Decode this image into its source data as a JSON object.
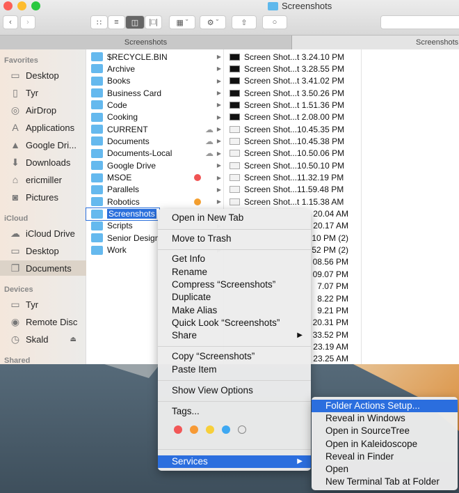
{
  "window": {
    "title": "Screenshots",
    "search_placeholder": ""
  },
  "toolbar": {
    "view_icons": [
      "icon-view-icon",
      "list-view-icon",
      "column-view-icon",
      "cover-flow-icon"
    ],
    "active_view": "column"
  },
  "tabs": [
    {
      "label": "Screenshots",
      "active": false
    },
    {
      "label": "Screenshots",
      "active": true
    }
  ],
  "sidebar": {
    "favorites_header": "Favorites",
    "favorites": [
      {
        "label": "Desktop",
        "icon": "desktop-icon"
      },
      {
        "label": "Tyr",
        "icon": "drive-icon"
      },
      {
        "label": "AirDrop",
        "icon": "airdrop-icon"
      },
      {
        "label": "Applications",
        "icon": "applications-icon"
      },
      {
        "label": "Google Dri...",
        "icon": "google-drive-icon"
      },
      {
        "label": "Downloads",
        "icon": "downloads-icon"
      },
      {
        "label": "ericmiller",
        "icon": "home-icon"
      },
      {
        "label": "Pictures",
        "icon": "camera-icon"
      }
    ],
    "icloud_header": "iCloud",
    "icloud": [
      {
        "label": "iCloud Drive",
        "icon": "cloud-icon"
      },
      {
        "label": "Desktop",
        "icon": "desktop-icon"
      },
      {
        "label": "Documents",
        "icon": "documents-icon",
        "selected": true
      }
    ],
    "devices_header": "Devices",
    "devices": [
      {
        "label": "Tyr",
        "icon": "laptop-icon"
      },
      {
        "label": "Remote Disc",
        "icon": "disc-icon"
      },
      {
        "label": "Skald",
        "icon": "timemachine-icon",
        "eject": true
      }
    ],
    "shared_header": "Shared"
  },
  "folders": [
    {
      "name": "$RECYCLE.BIN"
    },
    {
      "name": "Archive"
    },
    {
      "name": "Books"
    },
    {
      "name": "Business Card"
    },
    {
      "name": "Code"
    },
    {
      "name": "Cooking"
    },
    {
      "name": "CURRENT",
      "cloud": true
    },
    {
      "name": "Documents",
      "cloud": true
    },
    {
      "name": "Documents-Local",
      "cloud": true
    },
    {
      "name": "Google Drive"
    },
    {
      "name": "MSOE",
      "tag": "#f05454"
    },
    {
      "name": "Parallels"
    },
    {
      "name": "Robotics",
      "tag": "#f5a030"
    },
    {
      "name": "Screenshots",
      "selected": true
    },
    {
      "name": "Scripts"
    },
    {
      "name": "Senior Design"
    },
    {
      "name": "Work"
    }
  ],
  "files": [
    {
      "name": "Screen Shot...t 3.24.10 PM",
      "thumb": "dark"
    },
    {
      "name": "Screen Shot...t 3.28.55 PM",
      "thumb": "dark"
    },
    {
      "name": "Screen Shot...t 3.41.02 PM",
      "thumb": "dark"
    },
    {
      "name": "Screen Shot...t 3.50.26 PM",
      "thumb": "dark"
    },
    {
      "name": "Screen Shot...t 1.51.36 PM",
      "thumb": "dark"
    },
    {
      "name": "Screen Shot...t 2.08.00 PM",
      "thumb": "dark"
    },
    {
      "name": "Screen Shot...10.45.35 PM",
      "thumb": "light"
    },
    {
      "name": "Screen Shot...10.45.38 PM",
      "thumb": "light"
    },
    {
      "name": "Screen Shot...10.50.06 PM",
      "thumb": "light"
    },
    {
      "name": "Screen Shot...10.50.10 PM",
      "thumb": "light"
    },
    {
      "name": "Screen Shot...11.32.19 PM",
      "thumb": "light"
    },
    {
      "name": "Screen Shot...11.59.48 PM",
      "thumb": "light"
    },
    {
      "name": "Screen Shot...t 1.15.38 AM",
      "thumb": "light"
    },
    {
      "name": "20.04 AM",
      "partial": true
    },
    {
      "name": "20.17 AM",
      "partial": true
    },
    {
      "name": "10 PM (2)",
      "partial": true
    },
    {
      "name": "52 PM (2)",
      "partial": true
    },
    {
      "name": "08.56 PM",
      "partial": true
    },
    {
      "name": "09.07 PM",
      "partial": true
    },
    {
      "name": "7.07 PM",
      "partial": true
    },
    {
      "name": "8.22 PM",
      "partial": true
    },
    {
      "name": "9.21 PM",
      "partial": true
    },
    {
      "name": "20.31 PM",
      "partial": true
    },
    {
      "name": "33.52 PM",
      "partial": true
    },
    {
      "name": "23.19 AM",
      "partial": true
    },
    {
      "name": "23.25 AM",
      "partial": true
    }
  ],
  "context_menu": {
    "open_new_tab": "Open in New Tab",
    "move_trash": "Move to Trash",
    "get_info": "Get Info",
    "rename": "Rename",
    "compress": "Compress “Screenshots”",
    "duplicate": "Duplicate",
    "make_alias": "Make Alias",
    "quick_look": "Quick Look “Screenshots”",
    "share": "Share",
    "copy": "Copy “Screenshots”",
    "paste": "Paste Item",
    "view_options": "Show View Options",
    "tags": "Tags...",
    "services": "Services",
    "tag_colors": [
      "#f25757",
      "#f79a35",
      "#f7cf3a",
      "#3ea8f2",
      "#e8e8e8"
    ]
  },
  "services_menu": [
    "Folder Actions Setup...",
    "Reveal in Windows",
    "Open in SourceTree",
    "Open in Kaleidoscope",
    "Reveal in Finder",
    "Open",
    "New Terminal Tab at Folder"
  ],
  "colors": {
    "accent": "#2b6ede"
  }
}
